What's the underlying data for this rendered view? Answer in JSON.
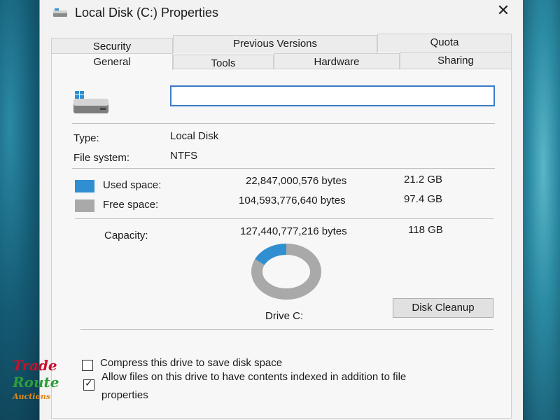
{
  "window": {
    "title": "Local Disk (C:) Properties",
    "close_glyph": "✕"
  },
  "tabs": {
    "row1": [
      "Security",
      "Previous Versions",
      "Quota"
    ],
    "row2": [
      "General",
      "Tools",
      "Hardware",
      "Sharing"
    ],
    "active": "General"
  },
  "general": {
    "name_value": "",
    "type_label": "Type:",
    "type_value": "Local Disk",
    "fs_label": "File system:",
    "fs_value": "NTFS",
    "used_label": "Used space:",
    "used_bytes": "22,847,000,576 bytes",
    "used_size": "21.2 GB",
    "free_label": "Free space:",
    "free_bytes": "104,593,776,640 bytes",
    "free_size": "97.4 GB",
    "capacity_label": "Capacity:",
    "capacity_bytes": "127,440,777,216 bytes",
    "capacity_size": "118 GB",
    "drive_label": "Drive C:",
    "cleanup_button": "Disk Cleanup",
    "used_fraction": 0.179,
    "compress_label": "Compress this drive to save disk space",
    "compress_checked": false,
    "index_label_line1": "Allow files on this drive to have contents indexed in addition to file",
    "index_label_line2": "properties",
    "index_checked": true
  },
  "colors": {
    "used": "#2f8fd1",
    "free": "#a9a9a9",
    "accent": "#3a7bc8"
  },
  "watermark": {
    "line1": "Trade",
    "line2": "Route",
    "line3": "Auctions"
  }
}
